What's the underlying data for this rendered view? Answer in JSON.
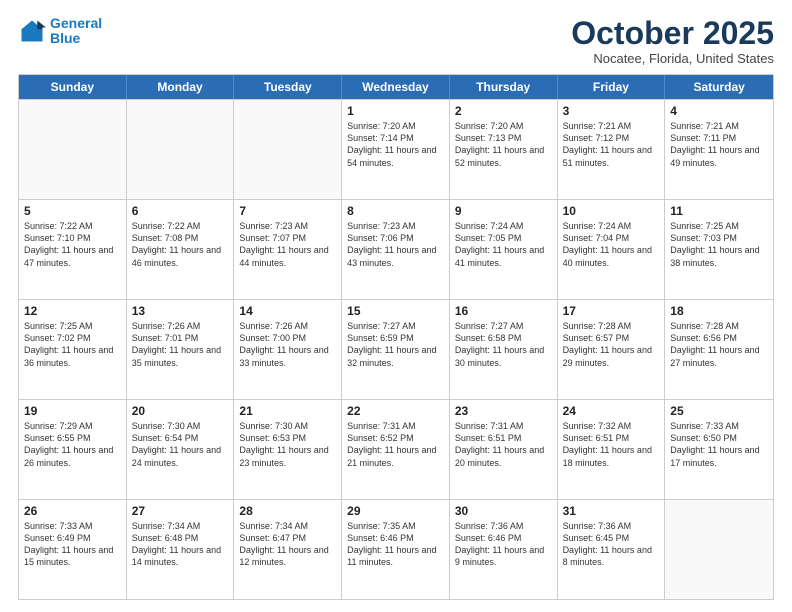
{
  "header": {
    "logo_line1": "General",
    "logo_line2": "Blue",
    "month": "October 2025",
    "location": "Nocatee, Florida, United States"
  },
  "weekdays": [
    "Sunday",
    "Monday",
    "Tuesday",
    "Wednesday",
    "Thursday",
    "Friday",
    "Saturday"
  ],
  "rows": [
    [
      {
        "day": "",
        "sunrise": "",
        "sunset": "",
        "daylight": ""
      },
      {
        "day": "",
        "sunrise": "",
        "sunset": "",
        "daylight": ""
      },
      {
        "day": "",
        "sunrise": "",
        "sunset": "",
        "daylight": ""
      },
      {
        "day": "1",
        "sunrise": "Sunrise: 7:20 AM",
        "sunset": "Sunset: 7:14 PM",
        "daylight": "Daylight: 11 hours and 54 minutes."
      },
      {
        "day": "2",
        "sunrise": "Sunrise: 7:20 AM",
        "sunset": "Sunset: 7:13 PM",
        "daylight": "Daylight: 11 hours and 52 minutes."
      },
      {
        "day": "3",
        "sunrise": "Sunrise: 7:21 AM",
        "sunset": "Sunset: 7:12 PM",
        "daylight": "Daylight: 11 hours and 51 minutes."
      },
      {
        "day": "4",
        "sunrise": "Sunrise: 7:21 AM",
        "sunset": "Sunset: 7:11 PM",
        "daylight": "Daylight: 11 hours and 49 minutes."
      }
    ],
    [
      {
        "day": "5",
        "sunrise": "Sunrise: 7:22 AM",
        "sunset": "Sunset: 7:10 PM",
        "daylight": "Daylight: 11 hours and 47 minutes."
      },
      {
        "day": "6",
        "sunrise": "Sunrise: 7:22 AM",
        "sunset": "Sunset: 7:08 PM",
        "daylight": "Daylight: 11 hours and 46 minutes."
      },
      {
        "day": "7",
        "sunrise": "Sunrise: 7:23 AM",
        "sunset": "Sunset: 7:07 PM",
        "daylight": "Daylight: 11 hours and 44 minutes."
      },
      {
        "day": "8",
        "sunrise": "Sunrise: 7:23 AM",
        "sunset": "Sunset: 7:06 PM",
        "daylight": "Daylight: 11 hours and 43 minutes."
      },
      {
        "day": "9",
        "sunrise": "Sunrise: 7:24 AM",
        "sunset": "Sunset: 7:05 PM",
        "daylight": "Daylight: 11 hours and 41 minutes."
      },
      {
        "day": "10",
        "sunrise": "Sunrise: 7:24 AM",
        "sunset": "Sunset: 7:04 PM",
        "daylight": "Daylight: 11 hours and 40 minutes."
      },
      {
        "day": "11",
        "sunrise": "Sunrise: 7:25 AM",
        "sunset": "Sunset: 7:03 PM",
        "daylight": "Daylight: 11 hours and 38 minutes."
      }
    ],
    [
      {
        "day": "12",
        "sunrise": "Sunrise: 7:25 AM",
        "sunset": "Sunset: 7:02 PM",
        "daylight": "Daylight: 11 hours and 36 minutes."
      },
      {
        "day": "13",
        "sunrise": "Sunrise: 7:26 AM",
        "sunset": "Sunset: 7:01 PM",
        "daylight": "Daylight: 11 hours and 35 minutes."
      },
      {
        "day": "14",
        "sunrise": "Sunrise: 7:26 AM",
        "sunset": "Sunset: 7:00 PM",
        "daylight": "Daylight: 11 hours and 33 minutes."
      },
      {
        "day": "15",
        "sunrise": "Sunrise: 7:27 AM",
        "sunset": "Sunset: 6:59 PM",
        "daylight": "Daylight: 11 hours and 32 minutes."
      },
      {
        "day": "16",
        "sunrise": "Sunrise: 7:27 AM",
        "sunset": "Sunset: 6:58 PM",
        "daylight": "Daylight: 11 hours and 30 minutes."
      },
      {
        "day": "17",
        "sunrise": "Sunrise: 7:28 AM",
        "sunset": "Sunset: 6:57 PM",
        "daylight": "Daylight: 11 hours and 29 minutes."
      },
      {
        "day": "18",
        "sunrise": "Sunrise: 7:28 AM",
        "sunset": "Sunset: 6:56 PM",
        "daylight": "Daylight: 11 hours and 27 minutes."
      }
    ],
    [
      {
        "day": "19",
        "sunrise": "Sunrise: 7:29 AM",
        "sunset": "Sunset: 6:55 PM",
        "daylight": "Daylight: 11 hours and 26 minutes."
      },
      {
        "day": "20",
        "sunrise": "Sunrise: 7:30 AM",
        "sunset": "Sunset: 6:54 PM",
        "daylight": "Daylight: 11 hours and 24 minutes."
      },
      {
        "day": "21",
        "sunrise": "Sunrise: 7:30 AM",
        "sunset": "Sunset: 6:53 PM",
        "daylight": "Daylight: 11 hours and 23 minutes."
      },
      {
        "day": "22",
        "sunrise": "Sunrise: 7:31 AM",
        "sunset": "Sunset: 6:52 PM",
        "daylight": "Daylight: 11 hours and 21 minutes."
      },
      {
        "day": "23",
        "sunrise": "Sunrise: 7:31 AM",
        "sunset": "Sunset: 6:51 PM",
        "daylight": "Daylight: 11 hours and 20 minutes."
      },
      {
        "day": "24",
        "sunrise": "Sunrise: 7:32 AM",
        "sunset": "Sunset: 6:51 PM",
        "daylight": "Daylight: 11 hours and 18 minutes."
      },
      {
        "day": "25",
        "sunrise": "Sunrise: 7:33 AM",
        "sunset": "Sunset: 6:50 PM",
        "daylight": "Daylight: 11 hours and 17 minutes."
      }
    ],
    [
      {
        "day": "26",
        "sunrise": "Sunrise: 7:33 AM",
        "sunset": "Sunset: 6:49 PM",
        "daylight": "Daylight: 11 hours and 15 minutes."
      },
      {
        "day": "27",
        "sunrise": "Sunrise: 7:34 AM",
        "sunset": "Sunset: 6:48 PM",
        "daylight": "Daylight: 11 hours and 14 minutes."
      },
      {
        "day": "28",
        "sunrise": "Sunrise: 7:34 AM",
        "sunset": "Sunset: 6:47 PM",
        "daylight": "Daylight: 11 hours and 12 minutes."
      },
      {
        "day": "29",
        "sunrise": "Sunrise: 7:35 AM",
        "sunset": "Sunset: 6:46 PM",
        "daylight": "Daylight: 11 hours and 11 minutes."
      },
      {
        "day": "30",
        "sunrise": "Sunrise: 7:36 AM",
        "sunset": "Sunset: 6:46 PM",
        "daylight": "Daylight: 11 hours and 9 minutes."
      },
      {
        "day": "31",
        "sunrise": "Sunrise: 7:36 AM",
        "sunset": "Sunset: 6:45 PM",
        "daylight": "Daylight: 11 hours and 8 minutes."
      },
      {
        "day": "",
        "sunrise": "",
        "sunset": "",
        "daylight": ""
      }
    ]
  ]
}
